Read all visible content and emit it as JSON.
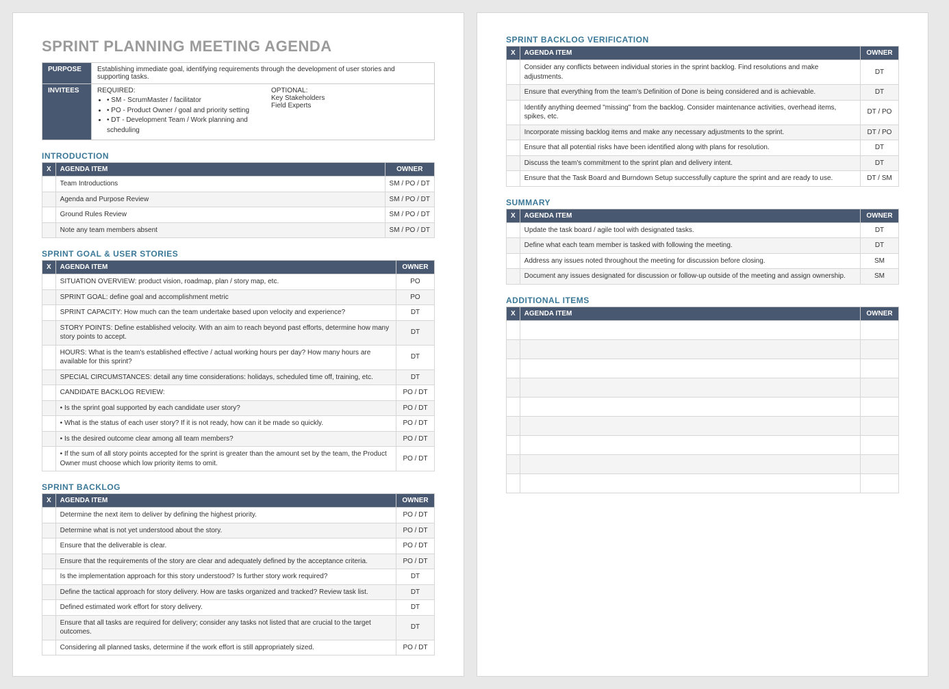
{
  "title": "SPRINT PLANNING MEETING AGENDA",
  "meta": {
    "purpose_label": "PURPOSE",
    "purpose_text": "Establishing immediate goal, identifying requirements through the development of user stories and supporting tasks.",
    "invitees_label": "INVITEES",
    "required_label": "REQUIRED:",
    "required_items": [
      "• SM - ScrumMaster / facilitator",
      "• PO - Product Owner / goal and priority setting",
      "• DT - Development Team / Work planning and scheduling"
    ],
    "optional_label": "OPTIONAL:",
    "optional_items": [
      "Key Stakeholders",
      "Field Experts"
    ]
  },
  "columns": {
    "x": "X",
    "item": "AGENDA ITEM",
    "owner": "OWNER"
  },
  "sections": {
    "introduction": {
      "title": "INTRODUCTION",
      "rows": [
        {
          "item": "Team Introductions",
          "owner": "SM / PO / DT"
        },
        {
          "item": "Agenda and Purpose Review",
          "owner": "SM / PO / DT"
        },
        {
          "item": "Ground Rules Review",
          "owner": "SM / PO / DT"
        },
        {
          "item": "Note any team members absent",
          "owner": "SM / PO / DT"
        }
      ]
    },
    "goal": {
      "title": "SPRINT GOAL & USER STORIES",
      "rows": [
        {
          "item": "SITUATION OVERVIEW: product vision, roadmap, plan / story map, etc.",
          "owner": "PO"
        },
        {
          "item": "SPRINT GOAL: define goal and accomplishment metric",
          "owner": "PO"
        },
        {
          "item": "SPRINT CAPACITY: How much can the team undertake based upon velocity and experience?",
          "owner": "DT"
        },
        {
          "item": "STORY POINTS: Define established velocity. With an aim to reach beyond past efforts, determine how many story points to accept.",
          "owner": "DT"
        },
        {
          "item": "HOURS: What is the team's established effective / actual working hours per day? How many hours are available for this sprint?",
          "owner": "DT"
        },
        {
          "item": "SPECIAL CIRCUMSTANCES: detail any time considerations: holidays, scheduled time off, training, etc.",
          "owner": "DT"
        },
        {
          "item": "CANDIDATE BACKLOG REVIEW:",
          "owner": "PO / DT"
        },
        {
          "item": "• Is the sprint goal supported by each candidate user story?",
          "owner": "PO / DT"
        },
        {
          "item": "• What is the status of each user story? If it is not ready, how can it be made so quickly.",
          "owner": "PO / DT"
        },
        {
          "item": "• Is the desired outcome clear among all team members?",
          "owner": "PO / DT"
        },
        {
          "item": "• If the sum of all story points accepted for the sprint is greater than the amount set by the team, the Product Owner must choose which low priority items to omit.",
          "owner": "PO / DT"
        }
      ]
    },
    "backlog": {
      "title": "SPRINT BACKLOG",
      "rows": [
        {
          "item": "Determine the next item to deliver by defining the highest priority.",
          "owner": "PO / DT"
        },
        {
          "item": "Determine what is not yet understood about the story.",
          "owner": "PO / DT"
        },
        {
          "item": "Ensure that the deliverable is clear.",
          "owner": "PO / DT"
        },
        {
          "item": "Ensure that the requirements of the story are clear and adequately defined by the acceptance criteria.",
          "owner": "PO / DT"
        },
        {
          "item": "Is the implementation approach for this story understood?  Is further story work required?",
          "owner": "DT"
        },
        {
          "item": "Define the tactical approach for story delivery.  How are tasks organized and tracked? Review task list.",
          "owner": "DT"
        },
        {
          "item": "Defined estimated work effort for story delivery.",
          "owner": "DT"
        },
        {
          "item": "Ensure that all tasks are required for delivery; consider any tasks not listed that are crucial to the target outcomes.",
          "owner": "DT"
        },
        {
          "item": "Considering all planned tasks, determine if the work effort is still appropriately sized.",
          "owner": "PO / DT"
        }
      ]
    },
    "verification": {
      "title": "SPRINT BACKLOG VERIFICATION",
      "rows": [
        {
          "item": "Consider any conflicts between individual stories in the sprint backlog. Find resolutions and make adjustments.",
          "owner": "DT"
        },
        {
          "item": "Ensure that everything from the team's Definition of Done is being considered and is achievable.",
          "owner": "DT"
        },
        {
          "item": "Identify anything deemed \"missing\" from the backlog. Consider maintenance activities, overhead items, spikes, etc.",
          "owner": "DT / PO"
        },
        {
          "item": "Incorporate missing backlog items and make any necessary adjustments to the sprint.",
          "owner": "DT / PO"
        },
        {
          "item": "Ensure that all potential risks have been identified along with plans for resolution.",
          "owner": "DT"
        },
        {
          "item": "Discuss the team's commitment to the sprint plan and delivery intent.",
          "owner": "DT"
        },
        {
          "item": "Ensure that the Task Board and Burndown Setup successfully capture the sprint and are ready to use.",
          "owner": "DT / SM"
        }
      ]
    },
    "summary": {
      "title": "SUMMARY",
      "rows": [
        {
          "item": "Update the task board / agile tool with designated tasks.",
          "owner": "DT"
        },
        {
          "item": "Define what each team member is tasked with following the meeting.",
          "owner": "DT"
        },
        {
          "item": "Address any issues noted throughout the meeting for discussion before closing.",
          "owner": "SM"
        },
        {
          "item": "Document any issues designated for discussion or follow-up outside of the meeting and assign ownership.",
          "owner": "SM"
        }
      ]
    },
    "additional": {
      "title": "ADDITIONAL ITEMS",
      "rows": [
        {
          "item": "",
          "owner": ""
        },
        {
          "item": "",
          "owner": ""
        },
        {
          "item": "",
          "owner": ""
        },
        {
          "item": "",
          "owner": ""
        },
        {
          "item": "",
          "owner": ""
        },
        {
          "item": "",
          "owner": ""
        },
        {
          "item": "",
          "owner": ""
        },
        {
          "item": "",
          "owner": ""
        },
        {
          "item": "",
          "owner": ""
        }
      ]
    }
  }
}
